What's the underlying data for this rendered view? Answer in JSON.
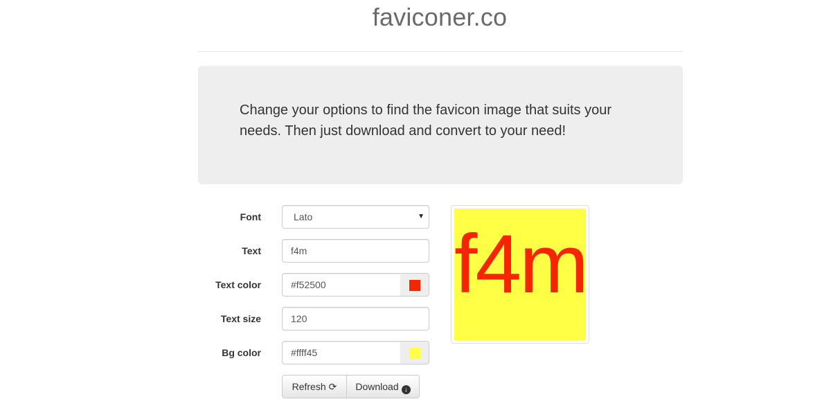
{
  "header": {
    "site_title": "faviconer.co"
  },
  "intro": {
    "text": "Change your options to find the favicon image that suits your needs. Then just download and convert to your need!"
  },
  "form": {
    "font": {
      "label": "Font",
      "selected": "Lato"
    },
    "text": {
      "label": "Text",
      "value": "f4m"
    },
    "text_color": {
      "label": "Text color",
      "value": "#f52500"
    },
    "text_size": {
      "label": "Text size",
      "value": "120"
    },
    "bg_color": {
      "label": "Bg color",
      "value": "#ffff45"
    }
  },
  "buttons": {
    "refresh_label": "Refresh",
    "download_label": "Download"
  },
  "icons": {
    "select_arrow": "chevron-down-icon",
    "refresh": "refresh-icon",
    "download": "download-icon"
  },
  "preview": {
    "text": "f4m",
    "text_color": "#f52500",
    "bg_color": "#ffff45"
  },
  "colors": {
    "jumbotron_bg": "#eeeeee",
    "title_color": "#6a6a6a"
  }
}
